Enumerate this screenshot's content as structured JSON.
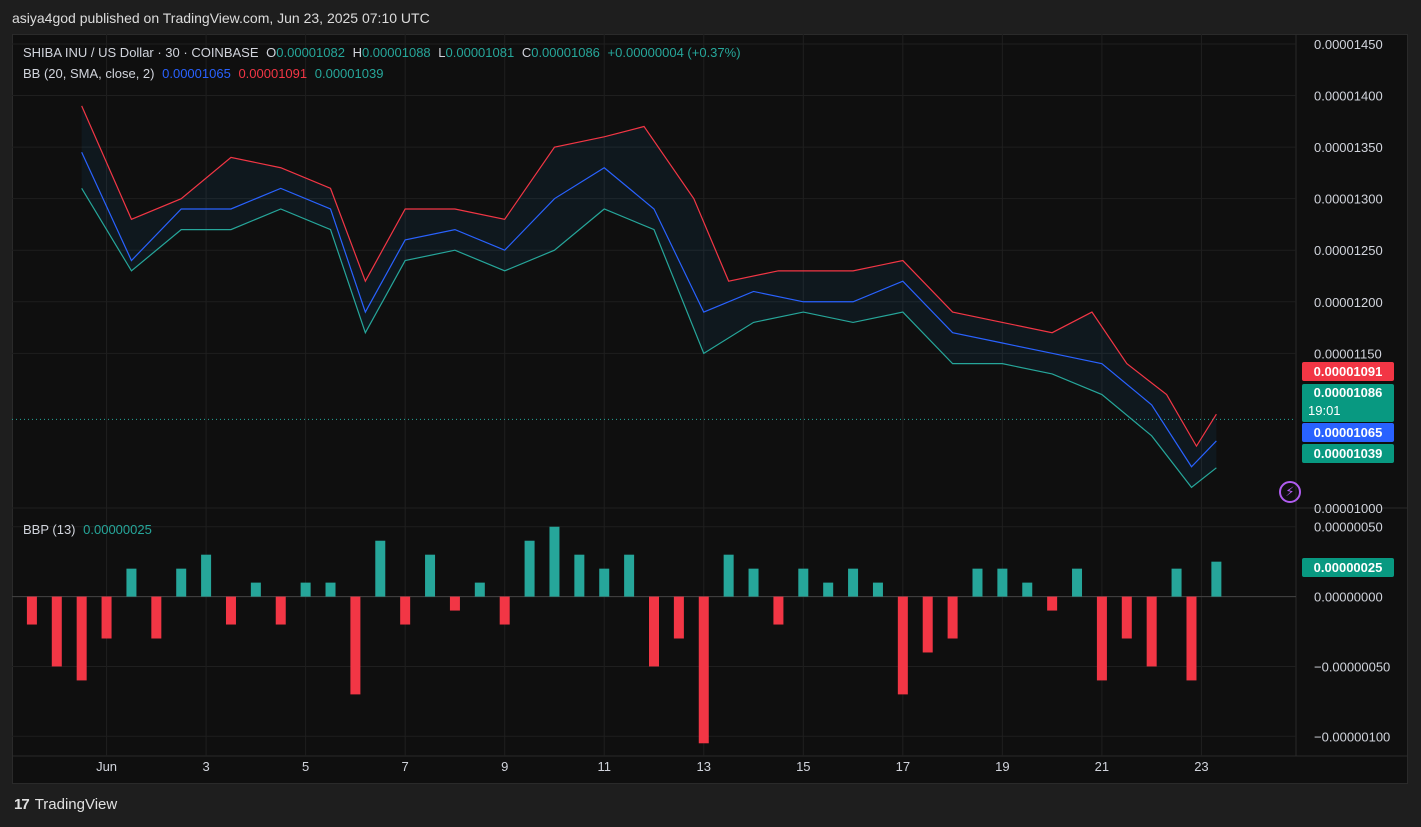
{
  "header": {
    "text": "asiya4god published on TradingView.com, Jun 23, 2025 07:10 UTC"
  },
  "legend": {
    "symbol": "SHIBA INU / US Dollar · 30 · COINBASE",
    "o_label": "O",
    "o_value": "0.00001082",
    "h_label": "H",
    "h_value": "0.00001088",
    "l_label": "L",
    "l_value": "0.00001081",
    "c_label": "C",
    "c_value": "0.00001086",
    "change": "+0.00000004 (+0.37%)",
    "bb_label": "BB (20, SMA, close, 2)",
    "bb_basis": "0.00001065",
    "bb_upper": "0.00001091",
    "bb_lower": "0.00001039",
    "bbp_label": "BBP (13)",
    "bbp_value": "0.00000025"
  },
  "price_tags": {
    "upper": "0.00001091",
    "last": "0.00001086",
    "countdown": "19:01",
    "basis": "0.00001065",
    "lower": "0.00001039",
    "bbp": "0.00000025"
  },
  "colors": {
    "up": "#26a69a",
    "down": "#f23645",
    "basis": "#2962ff",
    "upper": "#f23645",
    "lower": "#26a69a",
    "background": "#0f0f0f"
  },
  "footer": {
    "brand": "TradingView",
    "logo_icon": "tradingview-logo-icon"
  },
  "chart_data": [
    {
      "type": "line",
      "title": "SHIBA INU / US Dollar · 30 · COINBASE",
      "series": [
        {
          "name": "BB basis",
          "points": [
            [
              0.5,
              1.345e-05
            ],
            [
              1.5,
              1.24e-05
            ],
            [
              2.5,
              1.29e-05
            ],
            [
              3.5,
              1.29e-05
            ],
            [
              4.5,
              1.31e-05
            ],
            [
              5.5,
              1.29e-05
            ],
            [
              6.2,
              1.19e-05
            ],
            [
              7,
              1.26e-05
            ],
            [
              8,
              1.27e-05
            ],
            [
              9,
              1.25e-05
            ],
            [
              10,
              1.3e-05
            ],
            [
              11,
              1.33e-05
            ],
            [
              12,
              1.29e-05
            ],
            [
              13,
              1.19e-05
            ],
            [
              14,
              1.21e-05
            ],
            [
              15,
              1.2e-05
            ],
            [
              16,
              1.2e-05
            ],
            [
              17,
              1.22e-05
            ],
            [
              18,
              1.17e-05
            ],
            [
              19,
              1.16e-05
            ],
            [
              20,
              1.15e-05
            ],
            [
              21,
              1.14e-05
            ],
            [
              22,
              1.1e-05
            ],
            [
              22.8,
              1.04e-05
            ],
            [
              23.3,
              1.065e-05
            ]
          ]
        },
        {
          "name": "BB upper",
          "points": [
            [
              0.5,
              1.39e-05
            ],
            [
              1.5,
              1.28e-05
            ],
            [
              2.5,
              1.3e-05
            ],
            [
              3.5,
              1.34e-05
            ],
            [
              4.5,
              1.33e-05
            ],
            [
              5.5,
              1.31e-05
            ],
            [
              6.2,
              1.22e-05
            ],
            [
              7,
              1.29e-05
            ],
            [
              8,
              1.29e-05
            ],
            [
              9,
              1.28e-05
            ],
            [
              10,
              1.35e-05
            ],
            [
              11,
              1.36e-05
            ],
            [
              11.8,
              1.37e-05
            ],
            [
              12.8,
              1.3e-05
            ],
            [
              13.5,
              1.22e-05
            ],
            [
              14.5,
              1.23e-05
            ],
            [
              16,
              1.23e-05
            ],
            [
              17,
              1.24e-05
            ],
            [
              18,
              1.19e-05
            ],
            [
              19,
              1.18e-05
            ],
            [
              20,
              1.17e-05
            ],
            [
              20.8,
              1.19e-05
            ],
            [
              21.5,
              1.14e-05
            ],
            [
              22.3,
              1.11e-05
            ],
            [
              22.9,
              1.06e-05
            ],
            [
              23.3,
              1.091e-05
            ]
          ]
        },
        {
          "name": "BB lower",
          "points": [
            [
              0.5,
              1.31e-05
            ],
            [
              1.5,
              1.23e-05
            ],
            [
              2.5,
              1.27e-05
            ],
            [
              3.5,
              1.27e-05
            ],
            [
              4.5,
              1.29e-05
            ],
            [
              5.5,
              1.27e-05
            ],
            [
              6.2,
              1.17e-05
            ],
            [
              7,
              1.24e-05
            ],
            [
              8,
              1.25e-05
            ],
            [
              9,
              1.23e-05
            ],
            [
              10,
              1.25e-05
            ],
            [
              11,
              1.29e-05
            ],
            [
              12,
              1.27e-05
            ],
            [
              13,
              1.15e-05
            ],
            [
              14,
              1.18e-05
            ],
            [
              15,
              1.19e-05
            ],
            [
              16,
              1.18e-05
            ],
            [
              17,
              1.19e-05
            ],
            [
              18,
              1.14e-05
            ],
            [
              19,
              1.14e-05
            ],
            [
              20,
              1.13e-05
            ],
            [
              21,
              1.11e-05
            ],
            [
              22,
              1.07e-05
            ],
            [
              22.8,
              1.02e-05
            ],
            [
              23.3,
              1.039e-05
            ]
          ]
        }
      ],
      "last_price": 1.086e-05,
      "xlabel": "",
      "ylabel": "",
      "x_ticks": [
        "Jun",
        "3",
        "5",
        "7",
        "9",
        "11",
        "13",
        "15",
        "17",
        "19",
        "21",
        "23"
      ],
      "x_tick_values": [
        1,
        3,
        5,
        7,
        9,
        11,
        13,
        15,
        17,
        19,
        21,
        23
      ],
      "y_ticks": [
        "0.00001450",
        "0.00001400",
        "0.00001350",
        "0.00001300",
        "0.00001250",
        "0.00001200",
        "0.00001150",
        "0.00001000"
      ],
      "y_tick_values": [
        1.45e-05,
        1.4e-05,
        1.35e-05,
        1.3e-05,
        1.25e-05,
        1.2e-05,
        1.15e-05,
        1e-05
      ],
      "ylim": [
        1e-05,
        1.4597e-05
      ],
      "xlim": [
        -0.9,
        24.9
      ],
      "grid": true
    },
    {
      "type": "bar",
      "title": "BBP (13)",
      "series": [
        {
          "name": "BBP",
          "points": [
            [
              -0.5,
              -2e-07
            ],
            [
              0,
              -5e-07
            ],
            [
              0.5,
              -6e-07
            ],
            [
              1,
              -3e-07
            ],
            [
              1.5,
              2e-07
            ],
            [
              2,
              -3e-07
            ],
            [
              2.5,
              2e-07
            ],
            [
              3,
              3e-07
            ],
            [
              3.5,
              -2e-07
            ],
            [
              4,
              1e-07
            ],
            [
              4.5,
              -2e-07
            ],
            [
              5,
              1e-07
            ],
            [
              5.5,
              1e-07
            ],
            [
              6,
              -7e-07
            ],
            [
              6.5,
              4e-07
            ],
            [
              7,
              -2e-07
            ],
            [
              7.5,
              3e-07
            ],
            [
              8,
              -1e-07
            ],
            [
              8.5,
              1e-07
            ],
            [
              9,
              -2e-07
            ],
            [
              9.5,
              4e-07
            ],
            [
              10,
              5e-07
            ],
            [
              10.5,
              3e-07
            ],
            [
              11,
              2e-07
            ],
            [
              11.5,
              3e-07
            ],
            [
              12,
              -5e-07
            ],
            [
              12.5,
              -3e-07
            ],
            [
              13,
              -1.05e-06
            ],
            [
              13.5,
              3e-07
            ],
            [
              14,
              2e-07
            ],
            [
              14.5,
              -2e-07
            ],
            [
              15,
              2e-07
            ],
            [
              15.5,
              1e-07
            ],
            [
              16,
              2e-07
            ],
            [
              16.5,
              1e-07
            ],
            [
              17,
              -7e-07
            ],
            [
              17.5,
              -4e-07
            ],
            [
              18,
              -3e-07
            ],
            [
              18.5,
              2e-07
            ],
            [
              19,
              2e-07
            ],
            [
              19.5,
              1e-07
            ],
            [
              20,
              -1e-07
            ],
            [
              20.5,
              2e-07
            ],
            [
              21,
              -6e-07
            ],
            [
              21.5,
              -3e-07
            ],
            [
              22,
              -5e-07
            ],
            [
              22.5,
              2e-07
            ],
            [
              22.8,
              -6e-07
            ],
            [
              23.3,
              2.5e-07
            ]
          ]
        }
      ],
      "y_ticks": [
        "0.00000050",
        "0.00000000",
        "−0.00000050",
        "−0.00000100"
      ],
      "y_tick_values": [
        5e-07,
        0,
        -5e-07,
        -1e-06
      ],
      "ylim": [
        -1.141e-06,
        6.27e-07
      ],
      "xlim": [
        -0.9,
        24.9
      ]
    }
  ]
}
